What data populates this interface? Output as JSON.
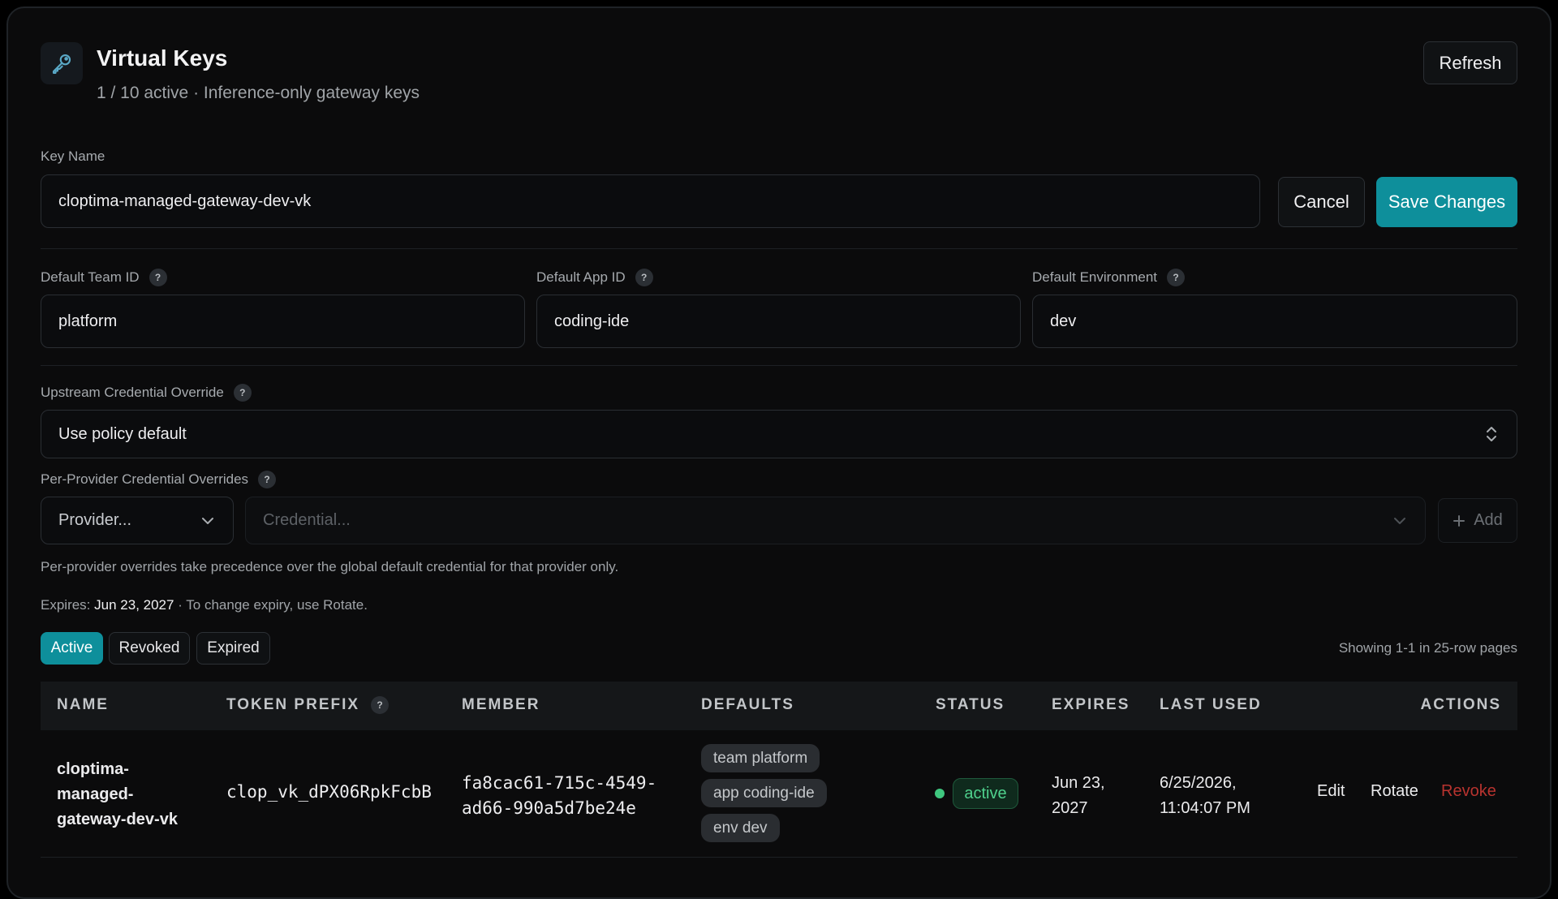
{
  "header": {
    "title": "Virtual Keys",
    "subtitle": "1 / 10 active · Inference-only gateway keys",
    "refresh_label": "Refresh",
    "icon": "key-icon"
  },
  "form": {
    "key_name_label": "Key Name",
    "key_name_value": "cloptima-managed-gateway-dev-vk",
    "cancel_label": "Cancel",
    "save_label": "Save Changes",
    "team_label": "Default Team ID",
    "team_value": "platform",
    "app_label": "Default App ID",
    "app_value": "coding-ide",
    "env_label": "Default Environment",
    "env_value": "dev",
    "help_glyph": "?",
    "upstream_label": "Upstream Credential Override",
    "upstream_value": "Use policy default",
    "per_provider_label": "Per-Provider Credential Overrides",
    "provider_placeholder": "Provider...",
    "credential_placeholder": "Credential...",
    "add_label": "Add",
    "per_provider_hint": "Per-provider overrides take precedence over the global default credential for that provider only.",
    "expires_prefix": "Expires:",
    "expires_date": "Jun 23, 2027",
    "expires_suffix": "· To change expiry, use Rotate."
  },
  "filters": {
    "tabs": [
      "Active",
      "Revoked",
      "Expired"
    ],
    "active_tab": "Active",
    "showing": "Showing 1-1 in 25-row pages"
  },
  "table": {
    "columns": [
      "NAME",
      "TOKEN PREFIX",
      "MEMBER",
      "DEFAULTS",
      "STATUS",
      "EXPIRES",
      "LAST USED",
      "ACTIONS"
    ],
    "rows": [
      {
        "name_lines": [
          "cloptima-",
          "managed-",
          "gateway-dev-vk"
        ],
        "token_prefix": "clop_vk_dPX06RpkFcbB",
        "member_lines": [
          "fa8cac61-715c-4549-",
          "ad66-990a5d7be24e"
        ],
        "defaults": [
          "team platform",
          "app coding-ide",
          "env dev"
        ],
        "status": "active",
        "expires_lines": [
          "Jun 23,",
          "2027"
        ],
        "last_used_lines": [
          "6/25/2026,",
          "11:04:07 PM"
        ],
        "actions": [
          "Edit",
          "Rotate",
          "Revoke"
        ]
      }
    ]
  },
  "colors": {
    "accent": "#0e8f9b",
    "status_active": "#4fd18d",
    "danger": "#b8332f"
  }
}
